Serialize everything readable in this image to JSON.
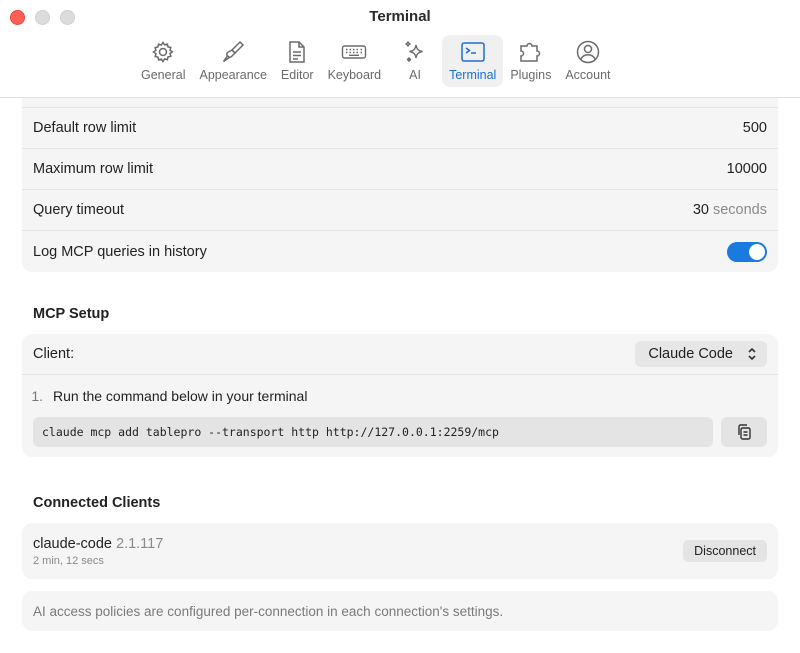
{
  "window": {
    "title": "Terminal"
  },
  "toolbar": {
    "items": [
      {
        "label": "General",
        "icon": "gear-icon"
      },
      {
        "label": "Appearance",
        "icon": "paintbrush-icon"
      },
      {
        "label": "Editor",
        "icon": "document-icon"
      },
      {
        "label": "Keyboard",
        "icon": "keyboard-icon"
      },
      {
        "label": "AI",
        "icon": "sparkles-icon"
      },
      {
        "label": "Terminal",
        "icon": "terminal-icon",
        "active": true
      },
      {
        "label": "Plugins",
        "icon": "puzzle-icon"
      },
      {
        "label": "Account",
        "icon": "person-circle-icon"
      }
    ]
  },
  "settings": {
    "rows": [
      {
        "label": "Default row limit",
        "value": "500"
      },
      {
        "label": "Maximum row limit",
        "value": "10000"
      },
      {
        "label": "Query timeout",
        "value": "30",
        "unit": "seconds"
      },
      {
        "label": "Log MCP queries in history",
        "toggle": true
      }
    ]
  },
  "mcp_setup": {
    "title": "MCP Setup",
    "client_label": "Client:",
    "client_value": "Claude Code",
    "step_number": "1.",
    "step_text": "Run the command below in your terminal",
    "command": "claude mcp add tablepro --transport http http://127.0.0.1:2259/mcp",
    "copy_icon": "copy-icon"
  },
  "connected_clients": {
    "title": "Connected Clients",
    "clients": [
      {
        "name": "claude-code",
        "version": "2.1.117",
        "duration": "2 min, 12 secs",
        "action": "Disconnect"
      }
    ]
  },
  "footer": {
    "note": "AI access policies are configured per-connection in each connection's settings."
  },
  "colors": {
    "accent": "#1a7ae0",
    "close": "#ff5f57"
  }
}
